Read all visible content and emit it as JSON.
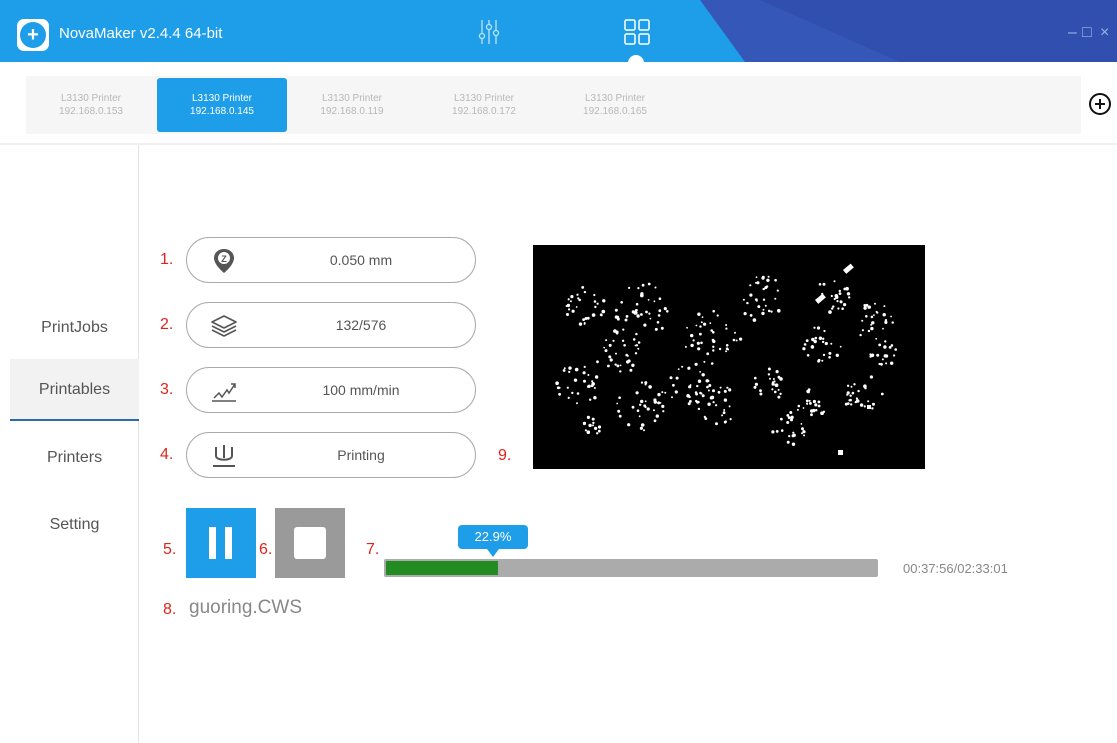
{
  "window": {
    "title": "NovaMaker v2.4.4 64-bit",
    "controls": [
      "–",
      "□",
      "×"
    ],
    "toolbar_icons": [
      "sliders-icon",
      "grid-icon"
    ]
  },
  "printer_tabs": [
    {
      "name": "L3130 Printer",
      "ip": "192.168.0.153",
      "active": false
    },
    {
      "name": "L3130 Printer",
      "ip": "192.168.0.145",
      "active": true
    },
    {
      "name": "L3130 Printer",
      "ip": "192.168.0.119",
      "active": false
    },
    {
      "name": "L3130 Printer",
      "ip": "192.168.0.172",
      "active": false
    },
    {
      "name": "L3130 Printer",
      "ip": "192.168.0.165",
      "active": false
    }
  ],
  "sidebar": {
    "items": [
      {
        "label": "PrintJobs",
        "active": false
      },
      {
        "label": "Printables",
        "active": true
      },
      {
        "label": "Printers",
        "active": false
      },
      {
        "label": "Setting",
        "active": false
      }
    ]
  },
  "markers": [
    "1.",
    "2.",
    "3.",
    "4.",
    "5.",
    "6.",
    "7.",
    "8.",
    "9."
  ],
  "status": {
    "layer_thickness": "0.050 mm",
    "layers": "132/576",
    "speed": "100 mm/min",
    "state": "Printing"
  },
  "progress": {
    "percent_label": "22.9%",
    "fraction": 0.229,
    "time": "00:37:56/02:33:01"
  },
  "file": {
    "name": "guoring.CWS"
  },
  "colors": {
    "accent": "#1e9ee8",
    "title_dark": "#3558b8",
    "progress": "#228b22",
    "marker": "#e0241c"
  }
}
